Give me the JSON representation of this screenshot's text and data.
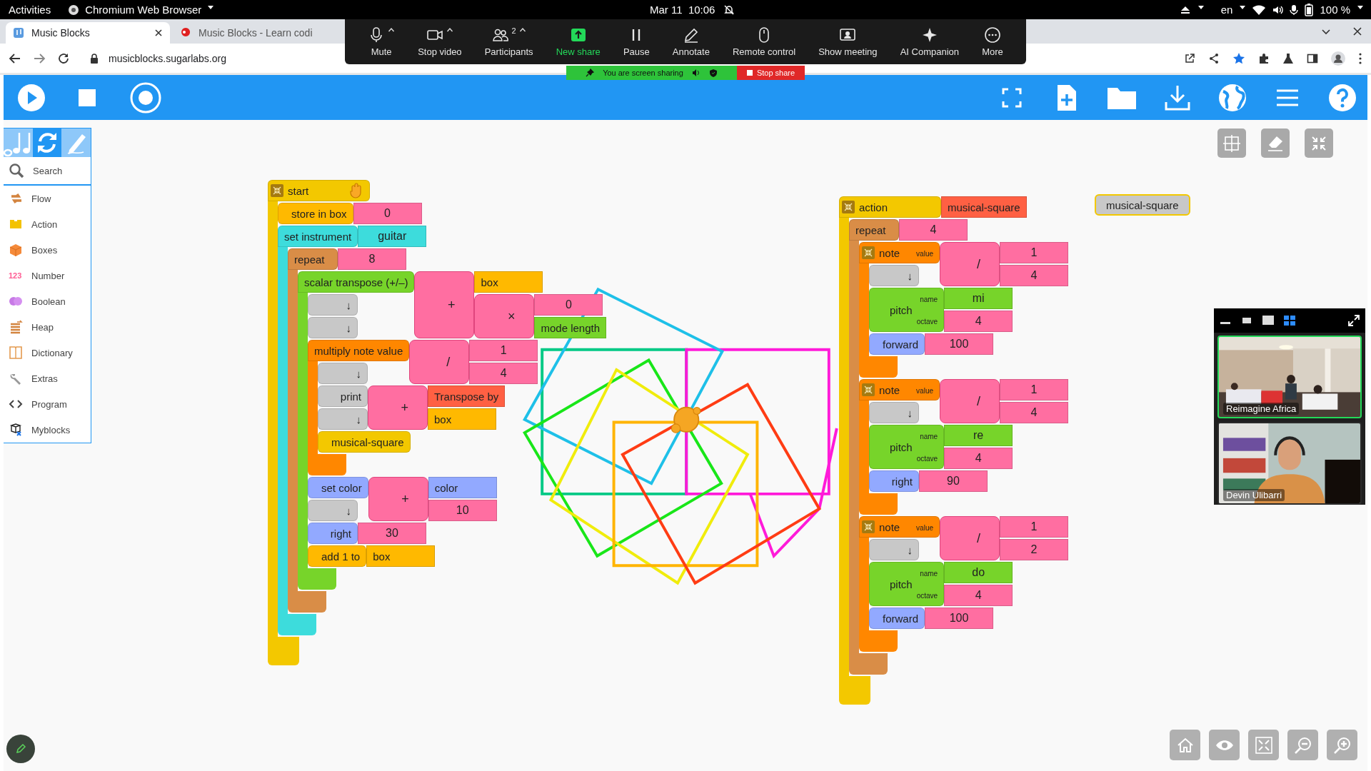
{
  "system_bar": {
    "activities": "Activities",
    "app_name": "Chromium Web Browser",
    "clock": "Mar 11  10:06",
    "language": "en",
    "battery": "100 %"
  },
  "browser": {
    "tabs": [
      {
        "title": "Music Blocks",
        "selected": true
      },
      {
        "title": "Music Blocks - Learn codi",
        "selected": false
      }
    ],
    "url": "musicblocks.sugarlabs.org"
  },
  "meeting_toolbar": {
    "buttons": [
      {
        "label": "Mute",
        "menu": true,
        "active": false
      },
      {
        "label": "Stop video",
        "menu": true,
        "active": false
      },
      {
        "label": "Participants",
        "count": "2",
        "menu": true,
        "active": false
      },
      {
        "label": "New share",
        "menu": false,
        "active": true
      },
      {
        "label": "Pause",
        "menu": false,
        "active": false
      },
      {
        "label": "Annotate",
        "menu": false,
        "active": false
      },
      {
        "label": "Remote control",
        "menu": false,
        "active": false
      },
      {
        "label": "Show meeting",
        "menu": false,
        "active": false
      },
      {
        "label": "AI Companion",
        "menu": false,
        "active": false
      },
      {
        "label": "More",
        "menu": false,
        "active": false
      }
    ],
    "sharing_notice": "You are screen sharing",
    "stop_share": "Stop share"
  },
  "palette": {
    "tabs": [
      {
        "selected": false
      },
      {
        "selected": true
      },
      {
        "selected": false
      }
    ],
    "search": "Search",
    "items": [
      {
        "label": "Flow"
      },
      {
        "label": "Action"
      },
      {
        "label": "Boxes"
      },
      {
        "label": "Number",
        "icon_text": "123"
      },
      {
        "label": "Boolean"
      },
      {
        "label": "Heap"
      },
      {
        "label": "Dictionary"
      },
      {
        "label": "Extras"
      },
      {
        "label": "Program"
      },
      {
        "label": "Myblocks"
      }
    ]
  },
  "program": {
    "stacks": [
      {
        "kind": "start",
        "color": "#f3c800",
        "label": "start",
        "collapsible": true,
        "children": [
          {
            "kind": "command",
            "color": "#ffb900",
            "label": "store in box",
            "args": [
              {
                "kind": "value",
                "color": "#ff6ea1",
                "text": "0"
              }
            ]
          },
          {
            "kind": "clamp",
            "color": "#3ddcdc",
            "label": "set instrument",
            "collapsible": false,
            "args": [
              {
                "kind": "value",
                "color": "#3ddcdc",
                "text": "guitar"
              }
            ],
            "children": [
              {
                "kind": "clamp",
                "color": "#d98d47",
                "label": "repeat",
                "collapsible": false,
                "args": [
                  {
                    "kind": "value",
                    "color": "#ff6ea1",
                    "text": "8"
                  }
                ],
                "children": [
                  {
                    "kind": "clamp",
                    "color": "#77d42a",
                    "label": "scalar transpose (+/–)",
                    "collapsible": false,
                    "args": [
                      {
                        "kind": "operator",
                        "color": "#ff6ea1",
                        "symbol": "+",
                        "args": [
                          {
                            "kind": "reference",
                            "color": "#ffb900",
                            "text": "box"
                          },
                          {
                            "kind": "operator",
                            "color": "#ff6ea1",
                            "symbol": "×",
                            "args": [
                              {
                                "kind": "value",
                                "color": "#ff6ea1",
                                "text": "0"
                              },
                              {
                                "kind": "reference",
                                "color": "#77d42a",
                                "text": "mode length"
                              }
                            ]
                          }
                        ]
                      }
                    ],
                    "children": [
                      {
                        "kind": "command",
                        "color": "#c8c8c8",
                        "label": "↓"
                      },
                      {
                        "kind": "command",
                        "color": "#c8c8c8",
                        "label": "↓"
                      },
                      {
                        "kind": "clamp",
                        "color": "#ff8700",
                        "label": "multiply note value",
                        "collapsible": false,
                        "args": [
                          {
                            "kind": "operator",
                            "color": "#ff6ea1",
                            "symbol": "/",
                            "args": [
                              {
                                "kind": "value",
                                "color": "#ff6ea1",
                                "text": "1"
                              },
                              {
                                "kind": "value",
                                "color": "#ff6ea1",
                                "text": "4"
                              }
                            ]
                          }
                        ],
                        "children": [
                          {
                            "kind": "command",
                            "color": "#c8c8c8",
                            "label": "↓"
                          },
                          {
                            "kind": "command",
                            "color": "#c8c8c8",
                            "label": "print",
                            "args": [
                              {
                                "kind": "operator",
                                "color": "#ff6ea1",
                                "symbol": "+",
                                "args": [
                                  {
                                    "kind": "reference",
                                    "color": "#ff6043",
                                    "text": "Transpose by"
                                  },
                                  {
                                    "kind": "reference",
                                    "color": "#ffb900",
                                    "text": "box"
                                  }
                                ]
                              }
                            ]
                          },
                          {
                            "kind": "command",
                            "color": "#c8c8c8",
                            "label": "↓"
                          },
                          {
                            "kind": "command",
                            "color": "#f3c800",
                            "label": "musical-square"
                          }
                        ]
                      },
                      {
                        "kind": "command",
                        "color": "#92a9ff",
                        "label": "set color",
                        "args": [
                          {
                            "kind": "operator",
                            "color": "#ff6ea1",
                            "symbol": "+",
                            "args": [
                              {
                                "kind": "reference",
                                "color": "#92a9ff",
                                "text": "color"
                              },
                              {
                                "kind": "value",
                                "color": "#ff6ea1",
                                "text": "10"
                              }
                            ]
                          }
                        ]
                      },
                      {
                        "kind": "command",
                        "color": "#c8c8c8",
                        "label": "↓"
                      },
                      {
                        "kind": "command",
                        "color": "#92a9ff",
                        "label": "right",
                        "args": [
                          {
                            "kind": "value",
                            "color": "#ff6ea1",
                            "text": "30"
                          }
                        ]
                      },
                      {
                        "kind": "command",
                        "color": "#ffb900",
                        "label": "add 1 to",
                        "args": [
                          {
                            "kind": "reference",
                            "color": "#ffb900",
                            "text": "box"
                          }
                        ]
                      }
                    ]
                  }
                ]
              }
            ]
          }
        ]
      },
      {
        "kind": "clamp",
        "color": "#f3c800",
        "label": "action",
        "collapsible": true,
        "args": [
          {
            "kind": "reference",
            "color": "#ff6043",
            "text": "musical-square"
          }
        ],
        "children": [
          {
            "kind": "clamp",
            "color": "#d98d47",
            "label": "repeat",
            "collapsible": false,
            "args": [
              {
                "kind": "value",
                "color": "#ff6ea1",
                "text": "4"
              }
            ],
            "children": [
              {
                "kind": "clamp",
                "color": "#ff8700",
                "label": "note",
                "collapsible": true,
                "args": [
                  {
                    "kind": "operator",
                    "color": "#ff6ea1",
                    "symbol": "/",
                    "label": "value",
                    "args": [
                      {
                        "kind": "value",
                        "color": "#ff6ea1",
                        "text": "1"
                      },
                      {
                        "kind": "value",
                        "color": "#ff6ea1",
                        "text": "4"
                      }
                    ]
                  }
                ],
                "children": [
                  {
                    "kind": "command",
                    "color": "#c8c8c8",
                    "label": "↓"
                  },
                  {
                    "kind": "command",
                    "color": "#77d42a",
                    "label": "pitch",
                    "args": [
                      {
                        "kind": "value",
                        "color": "#77d42a",
                        "label": "name",
                        "text": "mi"
                      },
                      {
                        "kind": "value",
                        "color": "#ff6ea1",
                        "label": "octave",
                        "text": "4"
                      }
                    ]
                  },
                  {
                    "kind": "command",
                    "color": "#92a9ff",
                    "label": "forward",
                    "args": [
                      {
                        "kind": "value",
                        "color": "#ff6ea1",
                        "text": "100"
                      }
                    ]
                  }
                ]
              },
              {
                "kind": "clamp",
                "color": "#ff8700",
                "label": "note",
                "collapsible": true,
                "args": [
                  {
                    "kind": "operator",
                    "color": "#ff6ea1",
                    "symbol": "/",
                    "label": "value",
                    "args": [
                      {
                        "kind": "value",
                        "color": "#ff6ea1",
                        "text": "1"
                      },
                      {
                        "kind": "value",
                        "color": "#ff6ea1",
                        "text": "4"
                      }
                    ]
                  }
                ],
                "children": [
                  {
                    "kind": "command",
                    "color": "#c8c8c8",
                    "label": "↓"
                  },
                  {
                    "kind": "command",
                    "color": "#77d42a",
                    "label": "pitch",
                    "args": [
                      {
                        "kind": "value",
                        "color": "#77d42a",
                        "label": "name",
                        "text": "re"
                      },
                      {
                        "kind": "value",
                        "color": "#ff6ea1",
                        "label": "octave",
                        "text": "4"
                      }
                    ]
                  },
                  {
                    "kind": "command",
                    "color": "#92a9ff",
                    "label": "right",
                    "args": [
                      {
                        "kind": "value",
                        "color": "#ff6ea1",
                        "text": "90"
                      }
                    ]
                  }
                ]
              },
              {
                "kind": "clamp",
                "color": "#ff8700",
                "label": "note",
                "collapsible": true,
                "args": [
                  {
                    "kind": "operator",
                    "color": "#ff6ea1",
                    "symbol": "/",
                    "label": "value",
                    "args": [
                      {
                        "kind": "value",
                        "color": "#ff6ea1",
                        "text": "1"
                      },
                      {
                        "kind": "value",
                        "color": "#ff6ea1",
                        "text": "2"
                      }
                    ]
                  }
                ],
                "children": [
                  {
                    "kind": "command",
                    "color": "#c8c8c8",
                    "label": "↓"
                  },
                  {
                    "kind": "command",
                    "color": "#77d42a",
                    "label": "pitch",
                    "args": [
                      {
                        "kind": "value",
                        "color": "#77d42a",
                        "label": "name",
                        "text": "do"
                      },
                      {
                        "kind": "value",
                        "color": "#ff6ea1",
                        "label": "octave",
                        "text": "4"
                      }
                    ]
                  },
                  {
                    "kind": "command",
                    "color": "#92a9ff",
                    "label": "forward",
                    "args": [
                      {
                        "kind": "value",
                        "color": "#ff6ea1",
                        "text": "100"
                      }
                    ]
                  }
                ]
              }
            ]
          }
        ]
      },
      {
        "kind": "ghost",
        "color": "#c8c8c8",
        "label": "musical-square"
      }
    ]
  },
  "video_panel": {
    "views": [
      {
        "selected": false
      },
      {
        "selected": false
      },
      {
        "selected": false
      },
      {
        "selected": true
      }
    ],
    "tiles": [
      {
        "kind": "picture",
        "name": "Reimagine Africa",
        "speaking": true
      },
      {
        "kind": "picture",
        "name": "Devin Ulibarri",
        "speaking": false
      }
    ]
  }
}
